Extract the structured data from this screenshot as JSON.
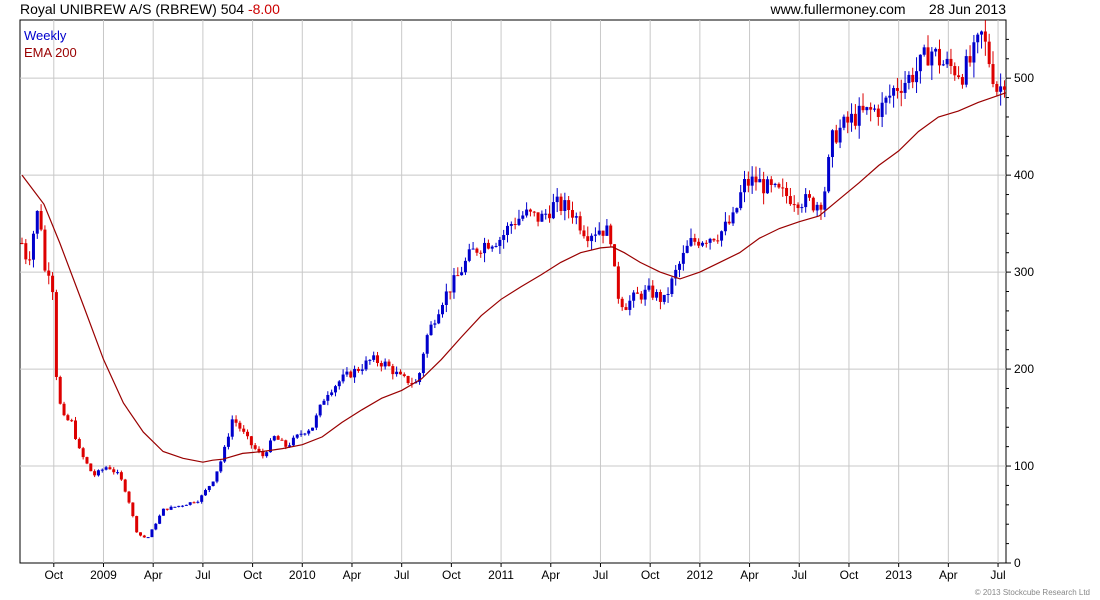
{
  "header": {
    "title": "Royal UNIBREW A/S (RBREW)",
    "last": "504",
    "change": "-8.00",
    "site": "www.fullermoney.com",
    "date": "28 Jun 2013"
  },
  "legend": {
    "weekly": "Weekly",
    "ema": "EMA 200"
  },
  "copyright": "© 2013 Stockcube Research Ltd",
  "colors": {
    "up": "#0000cc",
    "down": "#dd0000",
    "ema": "#990000",
    "grid": "#c8c8c8",
    "neg": "#cc0000"
  },
  "chart_data": {
    "type": "candlestick",
    "grid": true,
    "y_axis": {
      "range": [
        0,
        560
      ],
      "ticks": [
        0,
        100,
        200,
        300,
        400,
        500
      ],
      "side": "right"
    },
    "x_axis": {
      "range": [
        2008.58,
        2013.54
      ],
      "ticks": [
        {
          "x": 2008.75,
          "label": "Oct"
        },
        {
          "x": 2009.0,
          "label": "2009"
        },
        {
          "x": 2009.25,
          "label": "Apr"
        },
        {
          "x": 2009.5,
          "label": "Jul"
        },
        {
          "x": 2009.75,
          "label": "Oct"
        },
        {
          "x": 2010.0,
          "label": "2010"
        },
        {
          "x": 2010.25,
          "label": "Apr"
        },
        {
          "x": 2010.5,
          "label": "Jul"
        },
        {
          "x": 2010.75,
          "label": "Oct"
        },
        {
          "x": 2011.0,
          "label": "2011"
        },
        {
          "x": 2011.25,
          "label": "Apr"
        },
        {
          "x": 2011.5,
          "label": "Jul"
        },
        {
          "x": 2011.75,
          "label": "Oct"
        },
        {
          "x": 2012.0,
          "label": "2012"
        },
        {
          "x": 2012.25,
          "label": "Apr"
        },
        {
          "x": 2012.5,
          "label": "Jul"
        },
        {
          "x": 2012.75,
          "label": "Oct"
        },
        {
          "x": 2013.0,
          "label": "2013"
        },
        {
          "x": 2013.25,
          "label": "Apr"
        },
        {
          "x": 2013.5,
          "label": "Jul"
        }
      ]
    },
    "price_path": [
      [
        2008.59,
        330
      ],
      [
        2008.62,
        310
      ],
      [
        2008.66,
        355
      ],
      [
        2008.68,
        370
      ],
      [
        2008.7,
        300
      ],
      [
        2008.74,
        305
      ],
      [
        2008.76,
        200
      ],
      [
        2008.79,
        150
      ],
      [
        2008.84,
        145
      ],
      [
        2008.88,
        115
      ],
      [
        2008.95,
        90
      ],
      [
        2009.02,
        100
      ],
      [
        2009.08,
        90
      ],
      [
        2009.12,
        70
      ],
      [
        2009.17,
        30
      ],
      [
        2009.22,
        25
      ],
      [
        2009.26,
        40
      ],
      [
        2009.3,
        55
      ],
      [
        2009.4,
        60
      ],
      [
        2009.48,
        65
      ],
      [
        2009.55,
        85
      ],
      [
        2009.6,
        110
      ],
      [
        2009.65,
        150
      ],
      [
        2009.7,
        135
      ],
      [
        2009.75,
        120
      ],
      [
        2009.8,
        110
      ],
      [
        2009.86,
        130
      ],
      [
        2009.92,
        120
      ],
      [
        2010.0,
        135
      ],
      [
        2010.05,
        140
      ],
      [
        2010.12,
        175
      ],
      [
        2010.2,
        190
      ],
      [
        2010.28,
        200
      ],
      [
        2010.35,
        210
      ],
      [
        2010.42,
        205
      ],
      [
        2010.5,
        190
      ],
      [
        2010.58,
        185
      ],
      [
        2010.62,
        230
      ],
      [
        2010.7,
        270
      ],
      [
        2010.78,
        295
      ],
      [
        2010.85,
        320
      ],
      [
        2010.92,
        330
      ],
      [
        2011.0,
        335
      ],
      [
        2011.05,
        350
      ],
      [
        2011.12,
        360
      ],
      [
        2011.2,
        355
      ],
      [
        2011.27,
        370
      ],
      [
        2011.35,
        365
      ],
      [
        2011.43,
        340
      ],
      [
        2011.5,
        345
      ],
      [
        2011.55,
        340
      ],
      [
        2011.58,
        280
      ],
      [
        2011.62,
        265
      ],
      [
        2011.68,
        275
      ],
      [
        2011.75,
        280
      ],
      [
        2011.82,
        270
      ],
      [
        2011.88,
        300
      ],
      [
        2011.95,
        330
      ],
      [
        2012.02,
        335
      ],
      [
        2012.1,
        340
      ],
      [
        2012.17,
        355
      ],
      [
        2012.22,
        390
      ],
      [
        2012.28,
        395
      ],
      [
        2012.35,
        385
      ],
      [
        2012.42,
        380
      ],
      [
        2012.5,
        375
      ],
      [
        2012.58,
        370
      ],
      [
        2012.62,
        375
      ],
      [
        2012.67,
        440
      ],
      [
        2012.72,
        450
      ],
      [
        2012.78,
        460
      ],
      [
        2012.85,
        465
      ],
      [
        2012.92,
        470
      ],
      [
        2012.98,
        490
      ],
      [
        2013.05,
        500
      ],
      [
        2013.1,
        510
      ],
      [
        2013.16,
        530
      ],
      [
        2013.22,
        515
      ],
      [
        2013.28,
        510
      ],
      [
        2013.32,
        505
      ],
      [
        2013.37,
        520
      ],
      [
        2013.42,
        545
      ],
      [
        2013.46,
        515
      ],
      [
        2013.5,
        485
      ],
      [
        2013.54,
        504
      ]
    ],
    "ema_200": [
      [
        2008.59,
        400
      ],
      [
        2008.7,
        370
      ],
      [
        2008.78,
        330
      ],
      [
        2008.9,
        265
      ],
      [
        2009.0,
        210
      ],
      [
        2009.1,
        165
      ],
      [
        2009.2,
        135
      ],
      [
        2009.3,
        115
      ],
      [
        2009.4,
        108
      ],
      [
        2009.5,
        104
      ],
      [
        2009.55,
        106
      ],
      [
        2009.6,
        107
      ],
      [
        2009.7,
        113
      ],
      [
        2009.8,
        115
      ],
      [
        2009.9,
        118
      ],
      [
        2010.0,
        122
      ],
      [
        2010.1,
        130
      ],
      [
        2010.2,
        145
      ],
      [
        2010.3,
        158
      ],
      [
        2010.4,
        170
      ],
      [
        2010.5,
        178
      ],
      [
        2010.6,
        190
      ],
      [
        2010.7,
        210
      ],
      [
        2010.8,
        233
      ],
      [
        2010.9,
        255
      ],
      [
        2011.0,
        272
      ],
      [
        2011.1,
        285
      ],
      [
        2011.2,
        297
      ],
      [
        2011.3,
        310
      ],
      [
        2011.4,
        320
      ],
      [
        2011.5,
        325
      ],
      [
        2011.56,
        326
      ],
      [
        2011.62,
        320
      ],
      [
        2011.7,
        310
      ],
      [
        2011.8,
        300
      ],
      [
        2011.9,
        293
      ],
      [
        2012.0,
        300
      ],
      [
        2012.1,
        310
      ],
      [
        2012.2,
        320
      ],
      [
        2012.3,
        335
      ],
      [
        2012.4,
        345
      ],
      [
        2012.5,
        352
      ],
      [
        2012.6,
        358
      ],
      [
        2012.7,
        375
      ],
      [
        2012.8,
        392
      ],
      [
        2012.9,
        410
      ],
      [
        2013.0,
        425
      ],
      [
        2013.1,
        445
      ],
      [
        2013.2,
        460
      ],
      [
        2013.3,
        466
      ],
      [
        2013.4,
        475
      ],
      [
        2013.5,
        482
      ],
      [
        2013.54,
        485
      ]
    ]
  }
}
